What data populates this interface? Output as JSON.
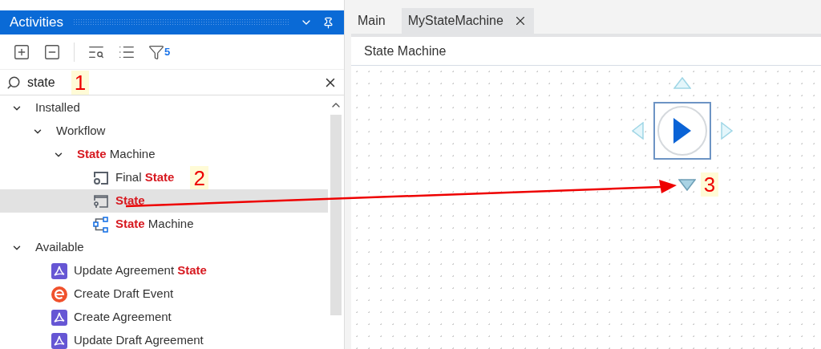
{
  "panel": {
    "title": "Activities",
    "filter_count": "5"
  },
  "search": {
    "value": "state",
    "callout": "1"
  },
  "tree": [
    {
      "label": "Installed",
      "kind": "category",
      "expanded": true,
      "selected": false,
      "children": [
        {
          "label": "Workflow",
          "kind": "category",
          "expanded": true,
          "selected": false,
          "children": [
            {
              "label": "**State** Machine",
              "kind": "category",
              "expanded": true,
              "selected": false,
              "children": [
                {
                  "label": "Final **State**",
                  "kind": "final-state",
                  "selected": false,
                  "callout": "2"
                },
                {
                  "label": "**State**",
                  "kind": "state",
                  "selected": true
                },
                {
                  "label": "**State** Machine",
                  "kind": "state-machine",
                  "selected": false
                }
              ]
            }
          ]
        }
      ]
    },
    {
      "label": "Available",
      "kind": "category",
      "expanded": true,
      "selected": false,
      "children": [
        {
          "label": "Update Agreement **State**",
          "kind": "pdf",
          "selected": false
        },
        {
          "label": "Create Draft Event",
          "kind": "event",
          "selected": false
        },
        {
          "label": "Create Agreement",
          "kind": "pdf",
          "selected": false
        },
        {
          "label": "Update Draft Agreement",
          "kind": "pdf",
          "selected": false
        }
      ]
    }
  ],
  "tabs": [
    {
      "label": "Main",
      "selected": false,
      "closable": false
    },
    {
      "label": "MyStateMachine",
      "selected": true,
      "closable": true
    }
  ],
  "designer": {
    "title": "State Machine",
    "callout": "3"
  }
}
